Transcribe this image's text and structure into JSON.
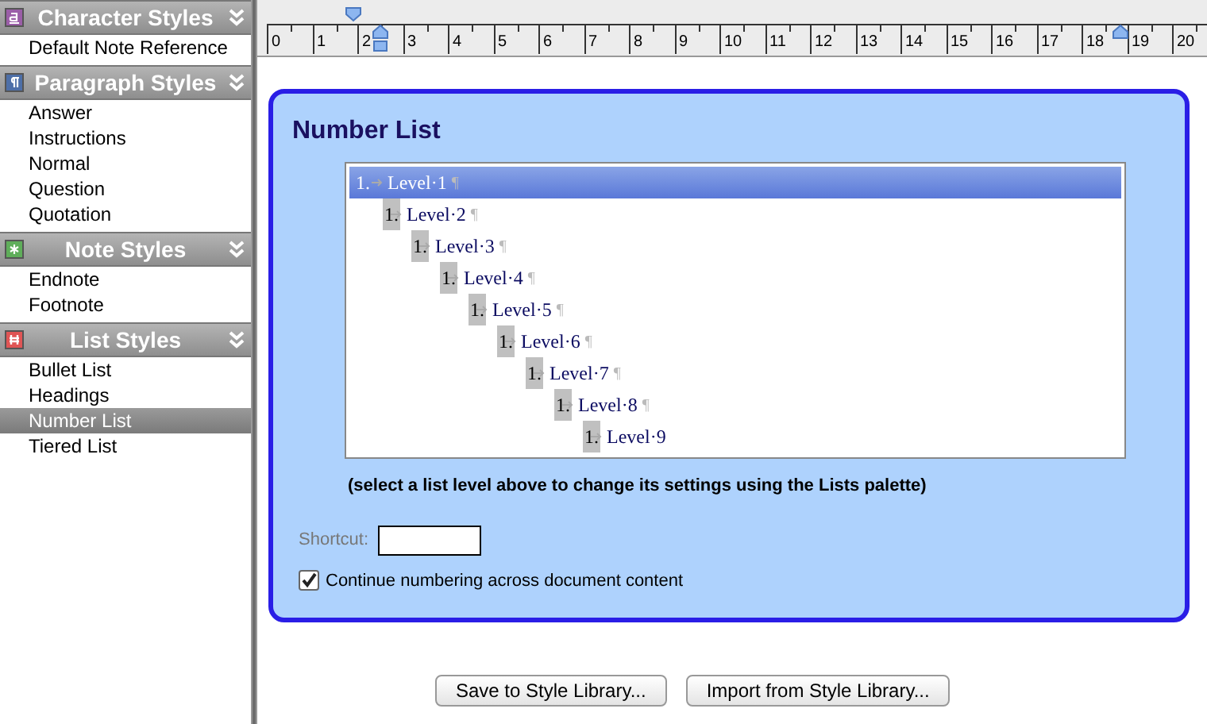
{
  "sidebar": {
    "sections": [
      {
        "kind": "character",
        "title": "Character Styles",
        "items": [
          {
            "label": "Default Note Reference",
            "selected": false
          }
        ]
      },
      {
        "kind": "paragraph",
        "title": "Paragraph Styles",
        "items": [
          {
            "label": "Answer",
            "selected": false
          },
          {
            "label": "Instructions",
            "selected": false
          },
          {
            "label": "Normal",
            "selected": false
          },
          {
            "label": "Question",
            "selected": false
          },
          {
            "label": "Quotation",
            "selected": false
          }
        ]
      },
      {
        "kind": "note",
        "title": "Note Styles",
        "items": [
          {
            "label": "Endnote",
            "selected": false
          },
          {
            "label": "Footnote",
            "selected": false
          }
        ]
      },
      {
        "kind": "list",
        "title": "List Styles",
        "items": [
          {
            "label": "Bullet List",
            "selected": false
          },
          {
            "label": "Headings",
            "selected": false
          },
          {
            "label": "Number List",
            "selected": true
          },
          {
            "label": "Tiered List",
            "selected": false
          }
        ]
      }
    ]
  },
  "ruler": {
    "labels": [
      "0",
      "1",
      "2",
      "3",
      "4",
      "5",
      "6",
      "7",
      "8",
      "9",
      "10",
      "11",
      "12",
      "13",
      "14",
      "15",
      "16",
      "17",
      "18",
      "19",
      "20"
    ]
  },
  "panel": {
    "title": "Number List",
    "levels": [
      {
        "number": "1.",
        "text": "Level·1",
        "end_mark": "¶",
        "selected": true,
        "children": [
          {
            "number": "1.",
            "text": "Level·2",
            "end_mark": "¶",
            "selected": false,
            "children": [
              {
                "number": "1.",
                "text": "Level·3",
                "end_mark": "¶",
                "selected": false,
                "children": [
                  {
                    "number": "1.",
                    "text": "Level·4",
                    "end_mark": "¶",
                    "selected": false,
                    "children": [
                      {
                        "number": "1.",
                        "text": "Level·5",
                        "end_mark": "¶",
                        "selected": false,
                        "children": [
                          {
                            "number": "1.",
                            "text": "Level·6",
                            "end_mark": "¶",
                            "selected": false,
                            "children": [
                              {
                                "number": "1.",
                                "text": "Level·7",
                                "end_mark": "¶",
                                "selected": false,
                                "children": [
                                  {
                                    "number": "1.",
                                    "text": "Level·8",
                                    "end_mark": "¶",
                                    "selected": false,
                                    "children": [
                                      {
                                        "number": "1.",
                                        "text": "Level·9",
                                        "selected": false
                                      }
                                    ]
                                  }
                                ]
                              }
                            ]
                          }
                        ]
                      }
                    ]
                  }
                ]
              }
            ]
          }
        ]
      }
    ],
    "hint": "(select a list level above to change its settings using the Lists palette)",
    "shortcut": {
      "label": "Shortcut:"
    },
    "continue_numbering": {
      "label": "Continue numbering across document content",
      "checked": true
    }
  },
  "buttons": [
    "Save to Style Library...",
    "Import from Style Library..."
  ]
}
